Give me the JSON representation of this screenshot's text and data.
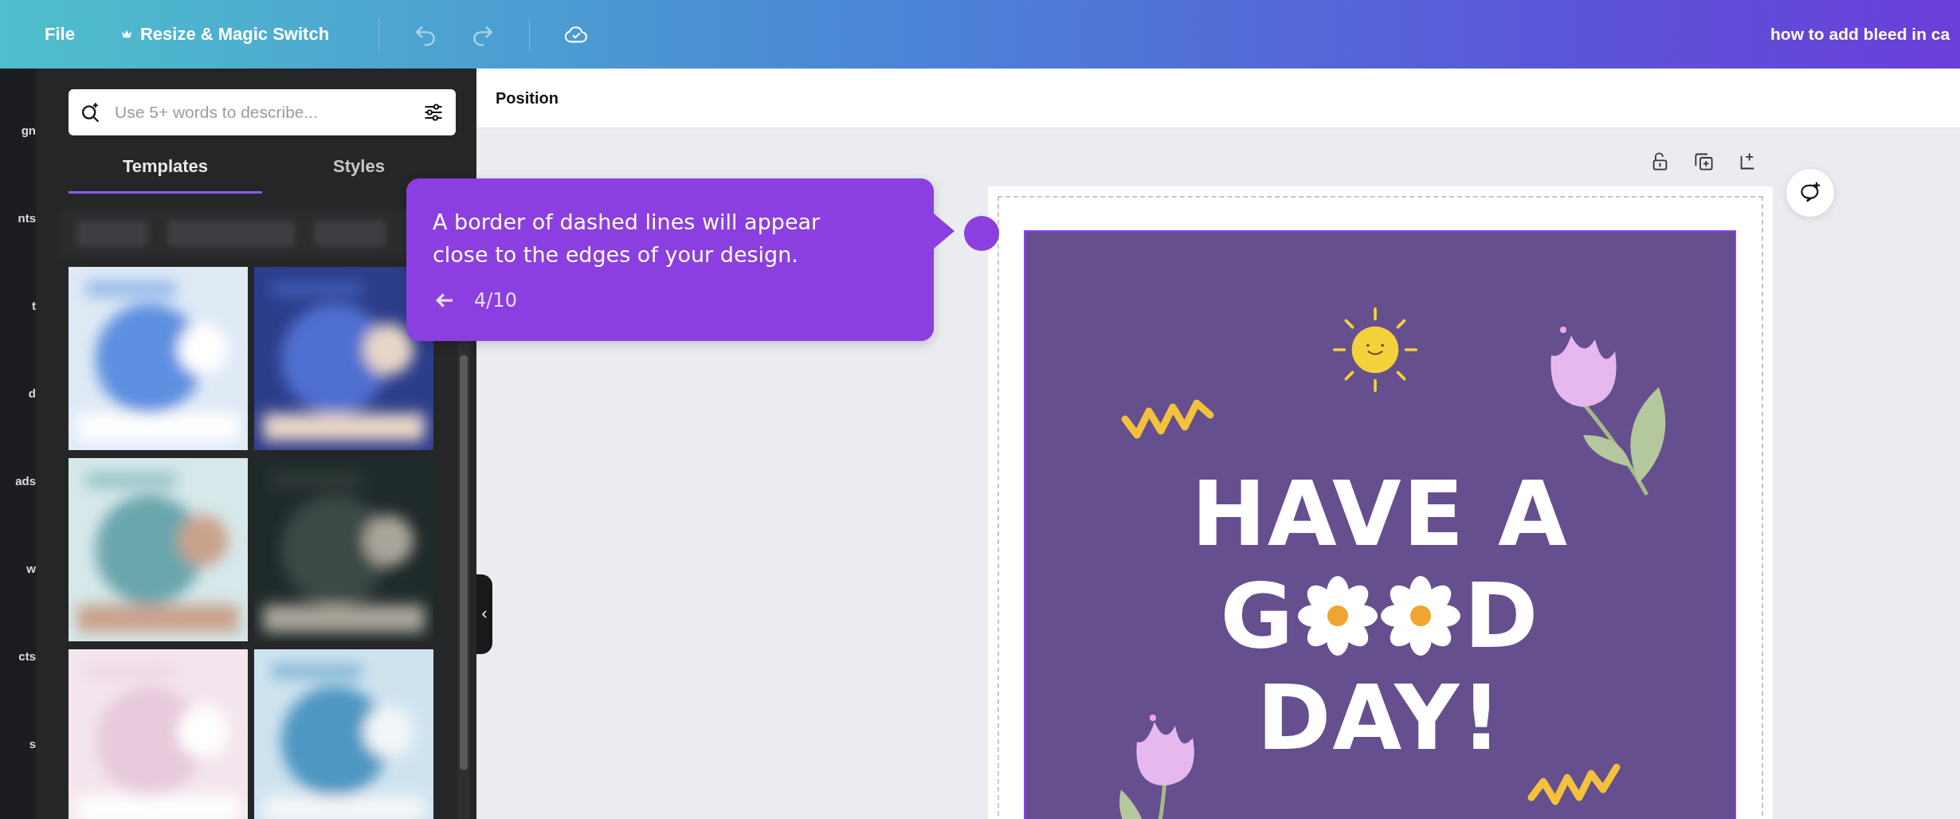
{
  "topbar": {
    "menu": [
      {
        "label": "File",
        "kind": "plain"
      },
      {
        "label": "Resize & Magic Switch",
        "kind": "crown"
      }
    ],
    "title": "how to add bleed in ca"
  },
  "rail": {
    "labels": [
      "gn",
      "nts",
      "t",
      "d",
      "ads",
      "w",
      "cts",
      "s"
    ]
  },
  "panel": {
    "search": {
      "placeholder": "Use 5+ words to describe..."
    },
    "tabs": [
      {
        "label": "Templates",
        "selected": true
      },
      {
        "label": "Styles",
        "selected": false
      }
    ]
  },
  "toolbar": {
    "label": "Position"
  },
  "tooltip": {
    "text": "A border of dashed lines will appear close to the edges of your design.",
    "step": "4/10"
  },
  "design": {
    "headline": "HAVE A",
    "word_start": "G",
    "word_end": "D",
    "last_line": "DAY!"
  }
}
